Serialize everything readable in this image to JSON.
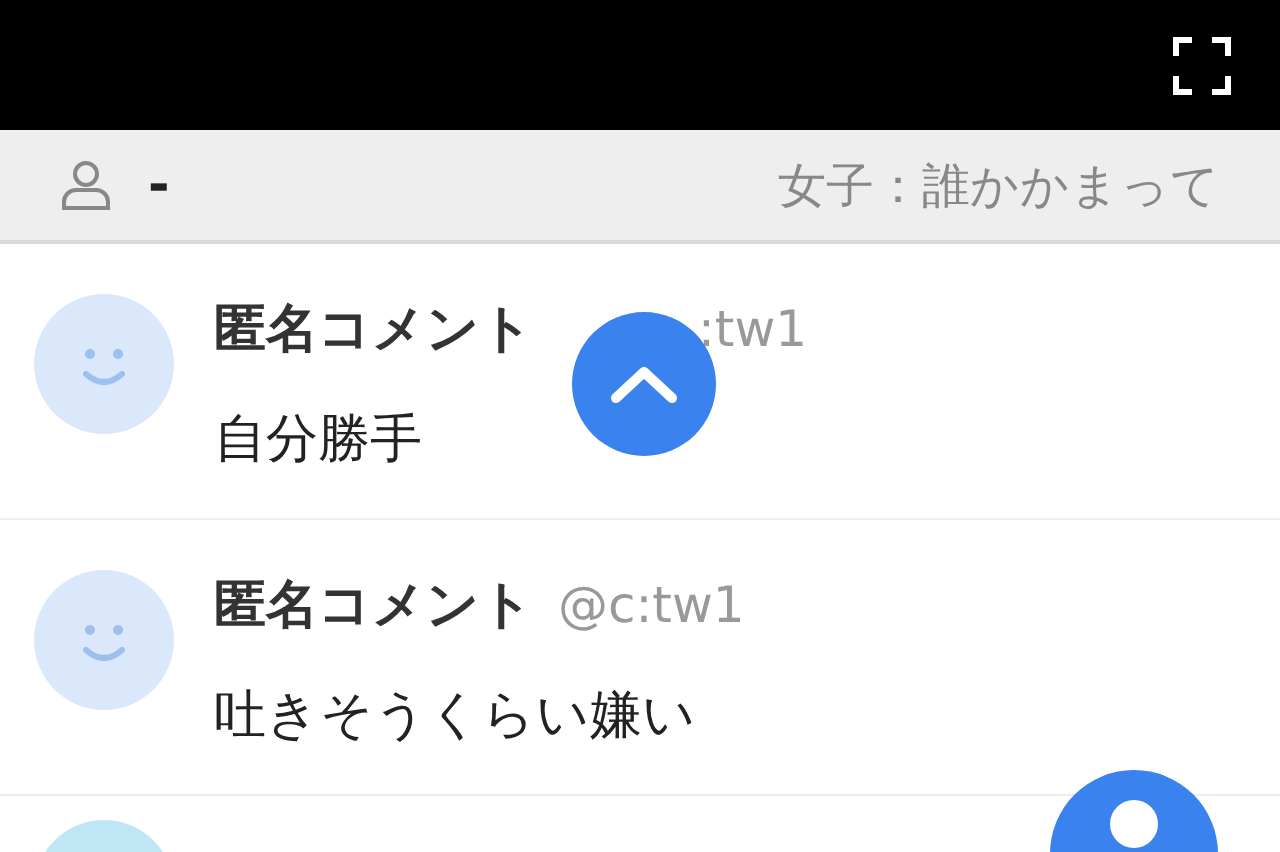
{
  "header": {
    "user_name": "-",
    "title": "女子：誰かかまって"
  },
  "comments": [
    {
      "name": "匿名コメント",
      "handle": ":tw1",
      "text": "自分勝手"
    },
    {
      "name": "匿名コメント",
      "handle": "@c:tw1",
      "text": "吐きそうくらい嫌い"
    },
    {
      "kind": "partial"
    }
  ]
}
